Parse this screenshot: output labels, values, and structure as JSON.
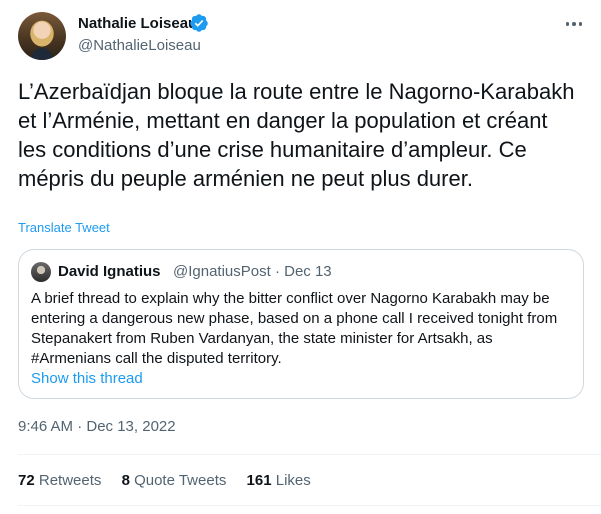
{
  "author": {
    "name": "Nathalie Loiseau",
    "handle": "@NathalieLoiseau"
  },
  "tweet": {
    "text": "L’Azerbaïdjan bloque la route entre le Nagorno-Karabakh et l’Arménie, mettant en danger la population et créant les conditions d’une crise humanitaire d’ampleur. Ce mépris du peuple arménien ne peut plus durer.",
    "translate_label": "Translate Tweet",
    "timestamp": "9:46 AM · Dec 13, 2022"
  },
  "quoted": {
    "name": "David Ignatius",
    "handle": "@IgnatiusPost",
    "separator": "·",
    "date": "Dec 13",
    "text": "A brief thread to explain why the bitter conflict over Nagorno Karabakh may be entering a dangerous new phase, based on a phone call I received tonight from Stepanakert from Ruben Vardanyan, the state minister for Artsakh, as #Armenians call the disputed territory.",
    "show_thread_label": "Show this thread"
  },
  "stats": {
    "retweets_count": "72",
    "retweets_label": "Retweets",
    "quotes_count": "8",
    "quotes_label": "Quote Tweets",
    "likes_count": "161",
    "likes_label": "Likes"
  },
  "icons": {
    "verified": "verified-badge-icon",
    "more": "more-options-icon"
  },
  "colors": {
    "accent": "#1d9bf0",
    "text": "#0f1419",
    "secondary": "#536471",
    "border": "#cfd9de"
  }
}
